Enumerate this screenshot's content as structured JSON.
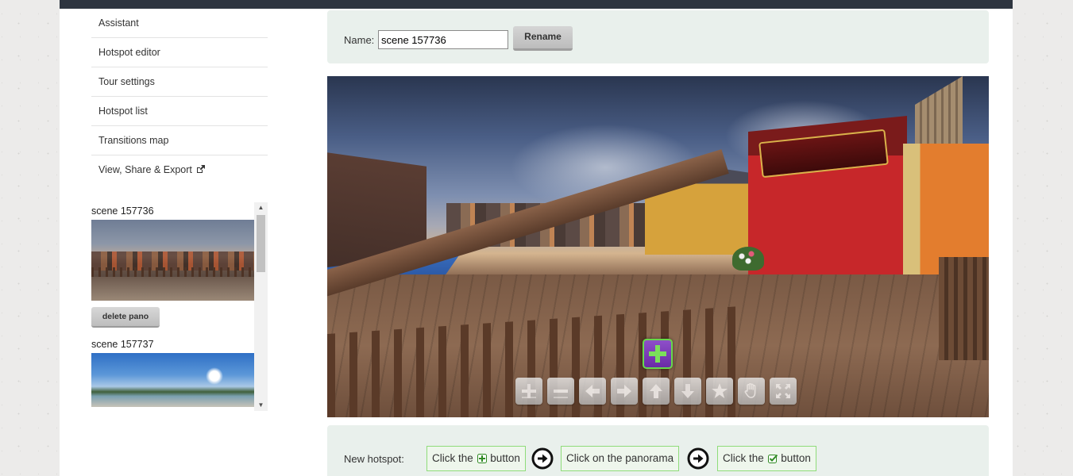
{
  "menu": {
    "items": [
      {
        "label": "Assistant"
      },
      {
        "label": "Hotspot editor"
      },
      {
        "label": "Tour settings"
      },
      {
        "label": "Hotspot list"
      },
      {
        "label": "Transitions map"
      },
      {
        "label": "View, Share & Export",
        "icon": "external-link-icon"
      }
    ]
  },
  "panos": [
    {
      "title": "scene 157736",
      "delete_label": "delete pano"
    },
    {
      "title": "scene 157737"
    }
  ],
  "name_panel": {
    "label": "Name:",
    "value": "scene 157736",
    "rename_label": "Rename"
  },
  "viewer": {
    "nav_buttons": [
      "zoom-in-icon",
      "zoom-out-icon",
      "arrow-left-icon",
      "arrow-right-icon",
      "arrow-up-icon",
      "arrow-down-icon",
      "star-icon",
      "hand-icon",
      "fullscreen-icon"
    ],
    "add_hotspot_icon": "plus-icon"
  },
  "instructions": {
    "label": "New hotspot:",
    "step1_pre": "Click the",
    "step1_post": "button",
    "step2": "Click on the panorama",
    "step3_pre": "Click the",
    "step3_post": "button"
  },
  "colors": {
    "topbar": "#2e3540",
    "panel_bg": "#e9f0ec",
    "hotspot_purple": "#7b3bbd",
    "hotspot_green": "#67d94a",
    "step_border": "#8fdc7a"
  }
}
